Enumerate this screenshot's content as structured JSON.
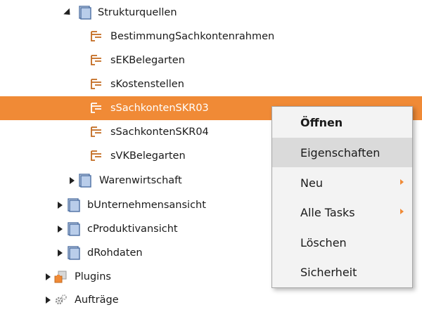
{
  "tree": {
    "strukturquellen": {
      "label": "Strukturquellen",
      "icon": "cube-icon"
    },
    "items": [
      {
        "label": "BestimmungSachkontenrahmen",
        "icon": "dimension-icon"
      },
      {
        "label": "sEKBelegarten",
        "icon": "dimension-icon"
      },
      {
        "label": "sKostenstellen",
        "icon": "dimension-icon"
      },
      {
        "label": "sSachkontenSKR03",
        "icon": "dimension-icon",
        "selected": true
      },
      {
        "label": "sSachkontenSKR04",
        "icon": "dimension-icon"
      },
      {
        "label": "sVKBelegarten",
        "icon": "dimension-icon"
      }
    ],
    "warenwirtschaft": {
      "label": "Warenwirtschaft",
      "icon": "cube-icon"
    },
    "unternehmensansicht": {
      "label": "bUnternehmensansicht",
      "icon": "cube-icon"
    },
    "produktivansicht": {
      "label": "cProduktivansicht",
      "icon": "cube-icon"
    },
    "rohdaten": {
      "label": "dRohdaten",
      "icon": "cube-icon"
    },
    "plugins": {
      "label": "Plugins",
      "icon": "plugin-icon"
    },
    "auftraege": {
      "label": "Aufträge",
      "icon": "tasks-gear-icon"
    }
  },
  "context_menu": {
    "items": [
      {
        "label": "Öffnen",
        "bold": true
      },
      {
        "label": "Eigenschaften",
        "hover": true
      },
      {
        "label": "Neu",
        "submenu": true
      },
      {
        "label": "Alle Tasks",
        "submenu": true
      },
      {
        "label": "Löschen"
      },
      {
        "label": "Sicherheit"
      }
    ]
  },
  "colors": {
    "selection": "#f08a36",
    "cube_fill": "#b9cdea",
    "cube_stroke": "#4d6fa3",
    "dimension": "#c26a1f",
    "menu_bg": "#f3f3f3",
    "menu_hover": "#dadada"
  }
}
